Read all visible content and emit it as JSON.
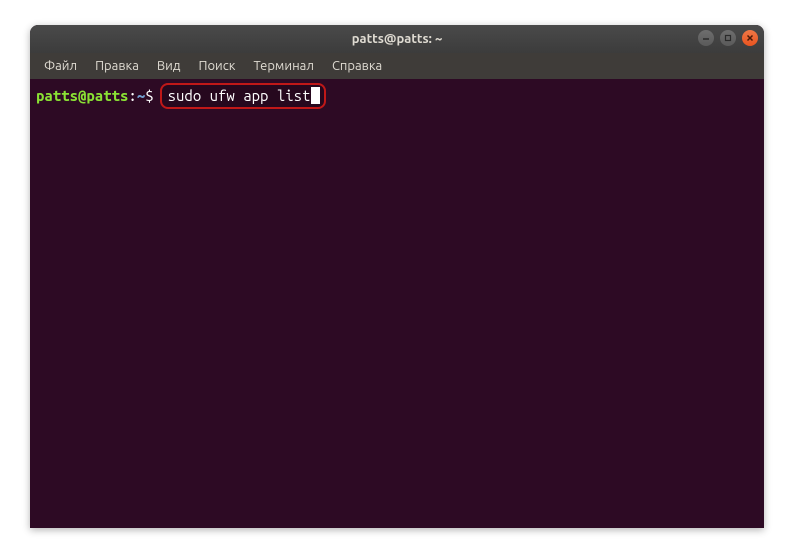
{
  "window": {
    "title": "patts@patts: ~"
  },
  "menubar": {
    "items": [
      {
        "label": "Файл"
      },
      {
        "label": "Правка"
      },
      {
        "label": "Вид"
      },
      {
        "label": "Поиск"
      },
      {
        "label": "Терминал"
      },
      {
        "label": "Справка"
      }
    ]
  },
  "terminal": {
    "prompt": {
      "user_host": "patts@patts",
      "colon": ":",
      "path": "~",
      "symbol": "$"
    },
    "command": "sudo ufw app list"
  },
  "controls": {
    "minimize": "−",
    "maximize": "□",
    "close": "×"
  }
}
